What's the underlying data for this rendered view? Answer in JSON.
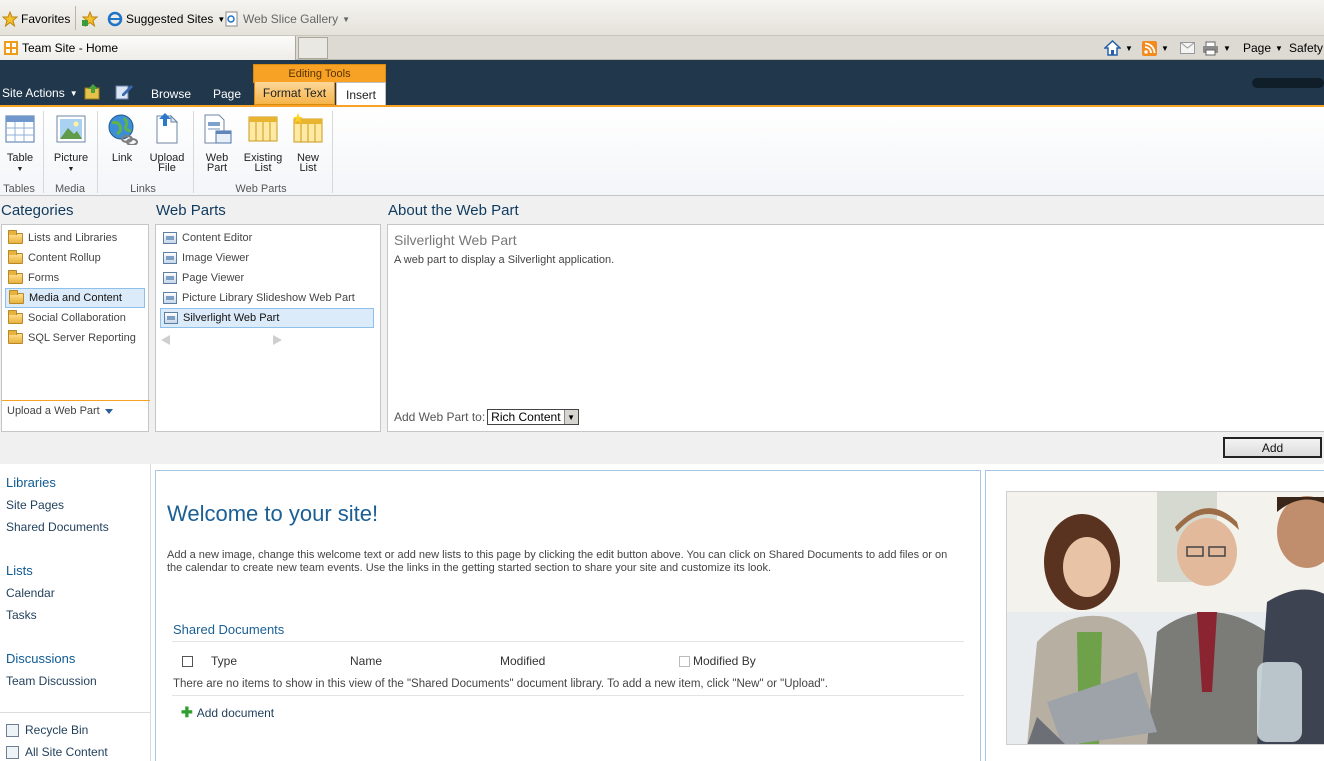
{
  "browser": {
    "favorites_label": "Favorites",
    "suggested_sites_label": "Suggested Sites",
    "web_slice_gallery_label": "Web Slice Gallery",
    "tab_title": "Team Site - Home",
    "commands": {
      "page_label": "Page",
      "safety_label": "Safety"
    }
  },
  "ribbon": {
    "site_actions_label": "Site Actions",
    "tabs": {
      "browse": "Browse",
      "page": "Page",
      "editing_tools": "Editing Tools",
      "format_text": "Format Text",
      "insert": "Insert"
    },
    "buttons": {
      "table": "Table",
      "picture": "Picture",
      "link": "Link",
      "upload_file_1": "Upload",
      "upload_file_2": "File",
      "web_part_1": "Web",
      "web_part_2": "Part",
      "existing_list_1": "Existing",
      "existing_list_2": "List",
      "new_list_1": "New",
      "new_list_2": "List"
    },
    "groups": {
      "tables": "Tables",
      "media": "Media",
      "links": "Links",
      "web_parts": "Web Parts"
    },
    "accent_color": "#f7a224",
    "header_color": "#21374c"
  },
  "adder": {
    "categories_title": "Categories",
    "web_parts_title": "Web Parts",
    "about_title": "About the Web Part",
    "categories": [
      "Lists and Libraries",
      "Content Rollup",
      "Forms",
      "Media and Content",
      "Social Collaboration",
      "SQL Server Reporting"
    ],
    "selected_category": "Media and Content",
    "web_parts": [
      "Content Editor",
      "Image Viewer",
      "Page Viewer",
      "Picture Library Slideshow Web Part",
      "Silverlight Web Part"
    ],
    "selected_web_part": "Silverlight Web Part",
    "upload_label": "Upload a Web Part",
    "about_name": "Silverlight Web Part",
    "about_description": "A web part to display a Silverlight application.",
    "add_to_label": "Add Web Part to:",
    "add_to_value": "Rich Content",
    "add_button": "Add"
  },
  "quick_launch": {
    "libraries_head": "Libraries",
    "site_pages": "Site Pages",
    "shared_documents": "Shared Documents",
    "lists_head": "Lists",
    "calendar": "Calendar",
    "tasks": "Tasks",
    "discussions_head": "Discussions",
    "team_discussion": "Team Discussion",
    "recycle_bin": "Recycle Bin",
    "all_site_content": "All Site Content"
  },
  "main": {
    "welcome_title": "Welcome to your site!",
    "welcome_text": "Add a new image, change this welcome text or add new lists to this page by clicking the edit button above. You can click on Shared Documents to add files or on the calendar to create new team events. Use the links in the getting started section to share your site and customize its look.",
    "shared_docs_title": "Shared Documents",
    "columns": {
      "type": "Type",
      "name": "Name",
      "modified": "Modified",
      "modified_by": "Modified By"
    },
    "empty_message": "There are no items to show in this view of the \"Shared Documents\" document library. To add a new item, click \"New\" or \"Upload\".",
    "add_document": "Add document"
  }
}
